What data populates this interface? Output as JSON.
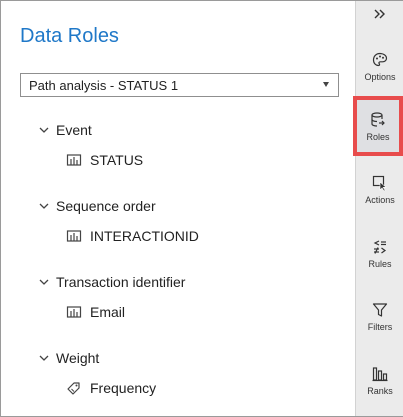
{
  "panel": {
    "title": "Data Roles",
    "select_value": "Path analysis - STATUS 1"
  },
  "roles": [
    {
      "name": "Event",
      "item": "STATUS",
      "item_icon": "measure-bars-icon"
    },
    {
      "name": "Sequence order",
      "item": "INTERACTIONID",
      "item_icon": "measure-bars-icon"
    },
    {
      "name": "Transaction identifier",
      "item": "Email",
      "item_icon": "measure-bars-icon"
    },
    {
      "name": "Weight",
      "item": "Frequency",
      "item_icon": "tag-icon"
    }
  ],
  "sidebar": {
    "collapse_icon": "double-chevron-right-icon",
    "items": [
      {
        "label": "Options",
        "icon": "palette-icon",
        "active": false
      },
      {
        "label": "Roles",
        "icon": "database-icon",
        "active": true
      },
      {
        "label": "Actions",
        "icon": "cursor-icon",
        "active": false
      },
      {
        "label": "Rules",
        "icon": "rules-icon",
        "active": false
      },
      {
        "label": "Filters",
        "icon": "funnel-icon",
        "active": false
      },
      {
        "label": "Ranks",
        "icon": "ranks-icon",
        "active": false
      }
    ]
  },
  "colors": {
    "title": "#1f78c8",
    "active_highlight_border": "#e84c4c",
    "sidebar_bg": "#ebebeb"
  }
}
